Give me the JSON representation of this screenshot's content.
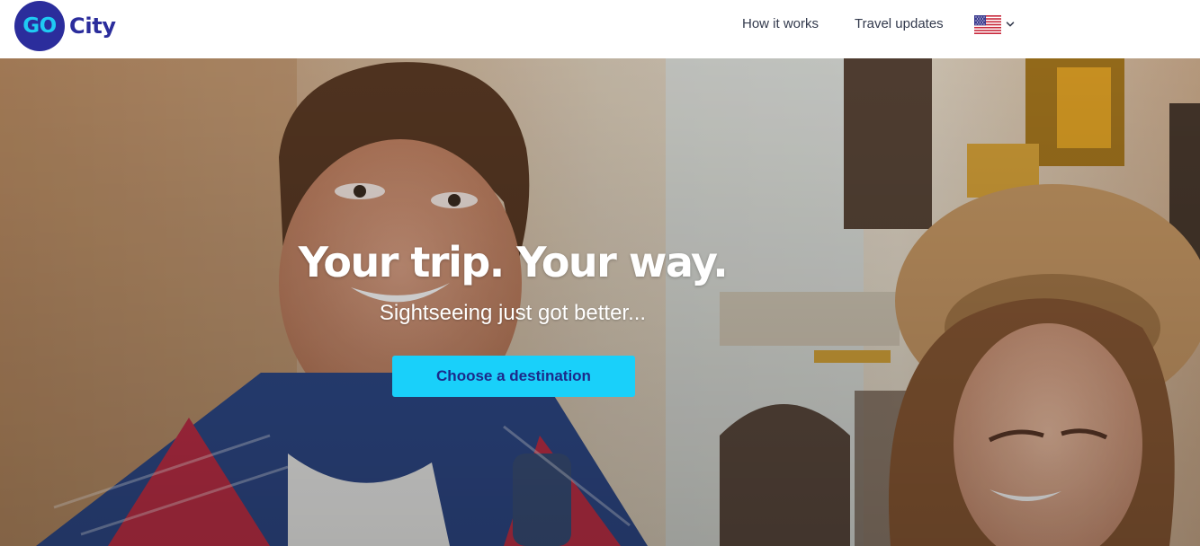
{
  "header": {
    "logo": {
      "badge_text": "GO",
      "wordmark": "City"
    },
    "nav": [
      {
        "label": "How it works"
      },
      {
        "label": "Travel updates"
      }
    ],
    "locale": {
      "flag_icon": "us-flag-icon",
      "dropdown_icon": "chevron-down-icon"
    }
  },
  "hero": {
    "headline": "Your trip. Your way.",
    "subheadline": "Sightseeing just got better...",
    "cta_label": "Choose a destination"
  },
  "colors": {
    "brand_navy": "#2b2d9c",
    "brand_cyan": "#1fcbf3",
    "cta_bg": "#19d0fa",
    "cta_text": "#1c2a8a",
    "nav_text": "#333a4d"
  }
}
